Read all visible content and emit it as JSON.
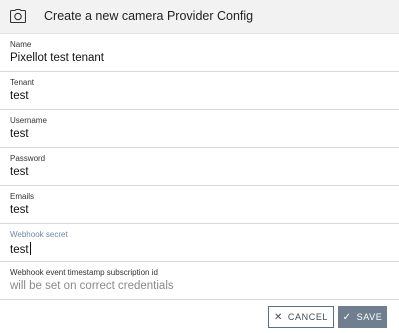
{
  "dialog": {
    "title": "Create a new camera Provider Config",
    "icon": "camera-icon"
  },
  "fields": [
    {
      "label": "Name",
      "value": "Pixellot test tenant"
    },
    {
      "label": "Tenant",
      "value": "test"
    },
    {
      "label": "Username",
      "value": "test"
    },
    {
      "label": "Password",
      "value": "test"
    },
    {
      "label": "Emails",
      "value": "test"
    },
    {
      "label": "Webhook secret",
      "value": "test",
      "focused": true
    },
    {
      "label": "Webhook event timestamp subscription id",
      "value": "will be set on correct credentials",
      "placeholder": true
    }
  ],
  "actions": {
    "cancel_label": "CANCEL",
    "cancel_icon": "close-icon",
    "save_label": "SAVE",
    "save_icon": "check-icon"
  },
  "colors": {
    "header_bg": "#f2f2f2",
    "focused_label": "#6f86a8",
    "save_bg": "#6f7f8f"
  }
}
